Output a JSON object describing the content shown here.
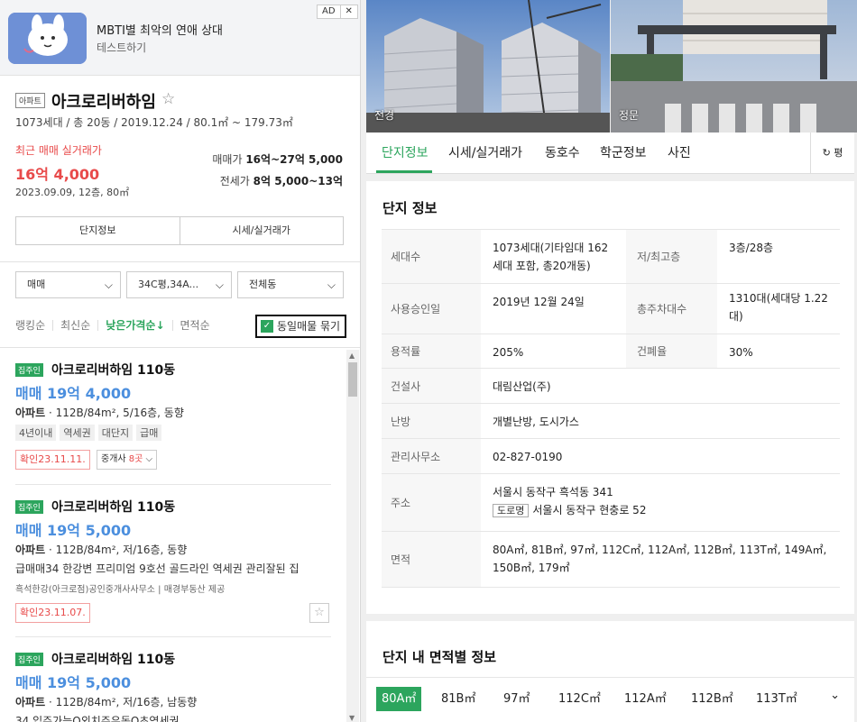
{
  "ad": {
    "title": "MBTI별 최악의 연애 상대",
    "subtitle": "테스트하기",
    "badge": "AD",
    "close": "✕"
  },
  "complex": {
    "type_tag": "아파트",
    "name": "아크로리버하임",
    "meta": "1073세대 / 총 20동 / 2019.12.24 / 80.1㎡ ~ 179.73㎡",
    "recent_label": "최근 매매 실거래가",
    "recent_price": "16억 4,000",
    "recent_date": "2023.09.09, 12층, 80㎡",
    "sale_label": "매매가",
    "sale_range": "16억~27억 5,000",
    "jeonse_label": "전세가",
    "jeonse_range": "8억 5,000~13억",
    "btn_info": "단지정보",
    "btn_price": "시세/실거래가"
  },
  "filters": {
    "trade": "매매",
    "area": "34C평,34A...",
    "dong": "전체동"
  },
  "sort": {
    "items": [
      "랭킹순",
      "최신순",
      "낮은가격순↓",
      "면적순"
    ],
    "same_listing": "동일매물 묶기"
  },
  "listings": [
    {
      "badge": "집주인",
      "title": "아크로리버하임 110동",
      "price": "매매 19억 4,000",
      "type": "아파트",
      "desc": "112B/84m², 5/16층, 동향",
      "tags": [
        "4년이내",
        "역세권",
        "대단지",
        "급매"
      ],
      "confirm": "확인23.11.11.",
      "agents_label": "중개사",
      "agents_count": "8곳"
    },
    {
      "badge": "집주인",
      "title": "아크로리버하임 110동",
      "price": "매매 19억 5,000",
      "type": "아파트",
      "desc": "112B/84m², 저/16층, 동향",
      "note": "급매매34 한강변 프리미엄 9호선 골드라인 역세권 관리잘된 집",
      "source": "흑석한강(아크로점)공인중개사사무소 | 매경부동산 제공",
      "confirm": "확인23.11.07."
    },
    {
      "badge": "집주인",
      "title": "아크로리버하임 110동",
      "price": "매매 19억 5,000",
      "type": "아파트",
      "desc": "112B/84m², 저/16층, 남동향",
      "note": "34 입주가능O외치주유동O초역세권"
    }
  ],
  "photos": [
    {
      "caption": "전경"
    },
    {
      "caption": "정문"
    }
  ],
  "tabs": {
    "items": [
      "단지정보",
      "시세/실거래가",
      "동호수",
      "학군정보",
      "사진"
    ],
    "unit": "↻ 평"
  },
  "info": {
    "title": "단지 정보",
    "households_label": "세대수",
    "households": "1073세대(기타임대 162세대 포함, 총20개동)",
    "floors_label": "저/최고층",
    "floors": "3층/28층",
    "approval_label": "사용승인일",
    "approval": "2019년 12월 24일",
    "parking_label": "총주차대수",
    "parking": "1310대(세대당 1.22대)",
    "far_label": "용적률",
    "far": "205%",
    "bcr_label": "건폐율",
    "bcr": "30%",
    "builder_label": "건설사",
    "builder": "대림산업(주)",
    "heating_label": "난방",
    "heating": "개별난방, 도시가스",
    "office_label": "관리사무소",
    "office": "02-827-0190",
    "address_label": "주소",
    "address": "서울시 동작구 흑석동 341",
    "road_tag": "도로명",
    "road_address": "서울시 동작구 현충로 52",
    "area_label": "면적",
    "areas": "80A㎡, 81B㎡, 97㎡, 112C㎡, 112A㎡, 112B㎡, 113T㎡, 149A㎡, 150B㎡, 179㎡"
  },
  "area_info": {
    "title": "단지 내 면적별 정보",
    "tabs": [
      "80A㎡",
      "81B㎡",
      "97㎡",
      "112C㎡",
      "112A㎡",
      "112B㎡",
      "113T㎡"
    ],
    "more": "⌄"
  },
  "colors": {
    "accent_green": "#2ca55d",
    "price_red": "#e84a4a",
    "price_blue": "#4c8fde"
  }
}
